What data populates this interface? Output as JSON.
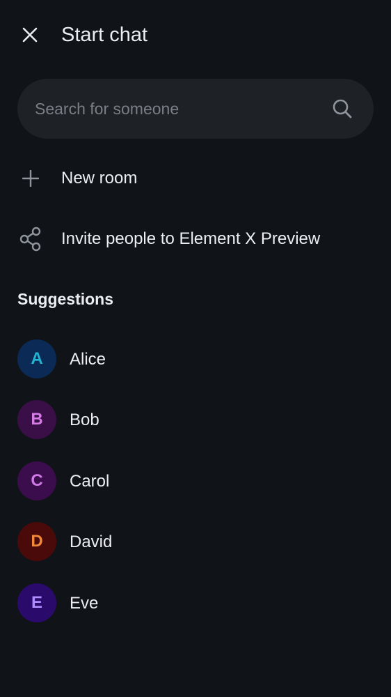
{
  "header": {
    "title": "Start chat",
    "close_icon": "close-icon"
  },
  "search": {
    "placeholder": "Search for someone",
    "value": "",
    "icon": "search-icon"
  },
  "actions": [
    {
      "label": "New room",
      "icon": "plus-icon"
    },
    {
      "label": "Invite people to Element X Preview",
      "icon": "share-icon"
    }
  ],
  "suggestions": {
    "title": "Suggestions",
    "users": [
      {
        "name": "Alice",
        "initial": "A",
        "bg": "#0b2a55",
        "fg": "#21b5d3"
      },
      {
        "name": "Bob",
        "initial": "B",
        "bg": "#3a0f48",
        "fg": "#d77ce6"
      },
      {
        "name": "Carol",
        "initial": "C",
        "bg": "#3b0d4c",
        "fg": "#cf79e7"
      },
      {
        "name": "David",
        "initial": "D",
        "bg": "#4b0a0a",
        "fg": "#f08a3a"
      },
      {
        "name": "Eve",
        "initial": "E",
        "bg": "#2a0a6a",
        "fg": "#b08bff"
      }
    ]
  },
  "colors": {
    "background": "#101317",
    "surface": "#1e2126",
    "text": "#ebeef2",
    "secondary_text": "#7a7f86",
    "icon": "#8f959c"
  }
}
